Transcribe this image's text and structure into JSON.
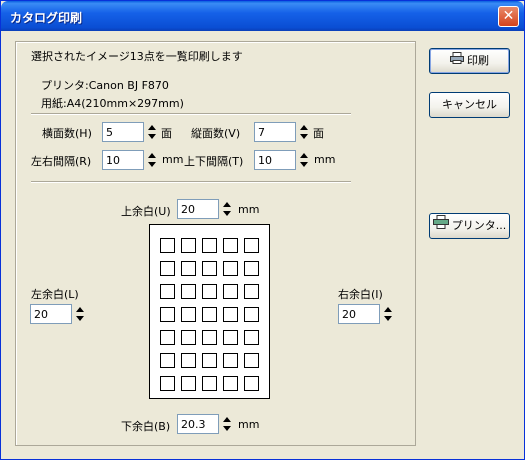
{
  "window": {
    "title": "カタログ印刷",
    "close_symbol": "✕"
  },
  "summary": "選択されたイメージ13点を一覧印刷します",
  "printer_line": "プリンタ:Canon BJ F870",
  "paper_line": "用紙:A4(210mm×297mm)",
  "layout": {
    "horizontal_count": {
      "label": "横面数(H)",
      "value": "5",
      "unit": "面"
    },
    "vertical_count": {
      "label": "縦面数(V)",
      "value": "7",
      "unit": "面"
    },
    "horizontal_spacing": {
      "label": "左右間隔(R)",
      "value": "10",
      "unit": "mm"
    },
    "vertical_spacing": {
      "label": "上下間隔(T)",
      "value": "10",
      "unit": "mm"
    }
  },
  "margins": {
    "top": {
      "label": "上余白(U)",
      "value": "20",
      "unit": "mm"
    },
    "left": {
      "label": "左余白(L)",
      "value": "20"
    },
    "right": {
      "label": "右余白(I)",
      "value": "20"
    },
    "bottom": {
      "label": "下余白(B)",
      "value": "20.3",
      "unit": "mm"
    }
  },
  "buttons": {
    "print": "印刷",
    "cancel": "キャンセル",
    "printer": "プリンタ..."
  },
  "preview": {
    "columns": 5,
    "rows": 7
  }
}
